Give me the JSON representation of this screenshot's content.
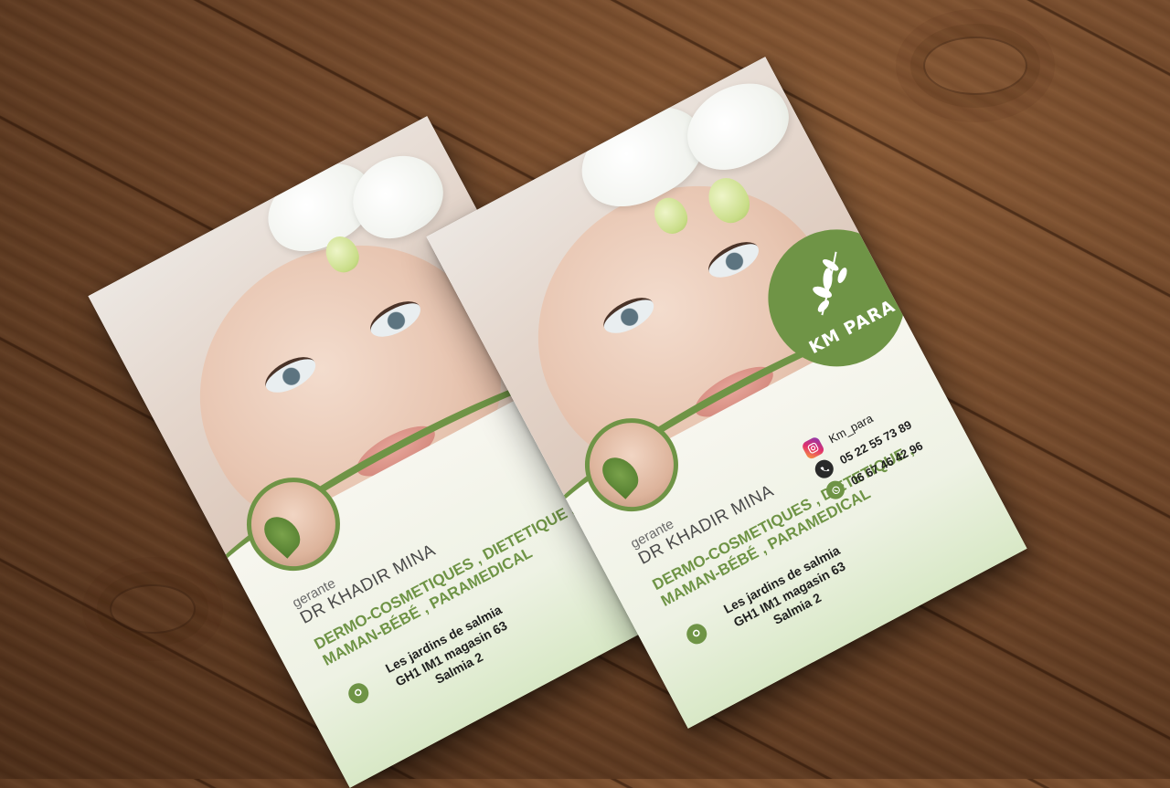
{
  "colors": {
    "brand_green": "#6f9446",
    "wood": "#6d4427"
  },
  "flyer": {
    "logo_text": "KM PARA",
    "logo_icon": "leaf-branch-icon",
    "role": "gerante",
    "doctor": "DR KHADIR MINA",
    "services_line1": "DERMO-COSMETIQUES , DIETETIQUE ,",
    "services_line2": "MAMAN-BÉBÉ , PARAMEDICAL",
    "address_line1": "Les jardins de salmia",
    "address_line2": "GH1 IM1 magasin 63",
    "address_line3": "Salmia 2",
    "instagram": "Km_para",
    "phone1": "05 22 55 73 89",
    "phone2": "06 67 46 42 96"
  }
}
